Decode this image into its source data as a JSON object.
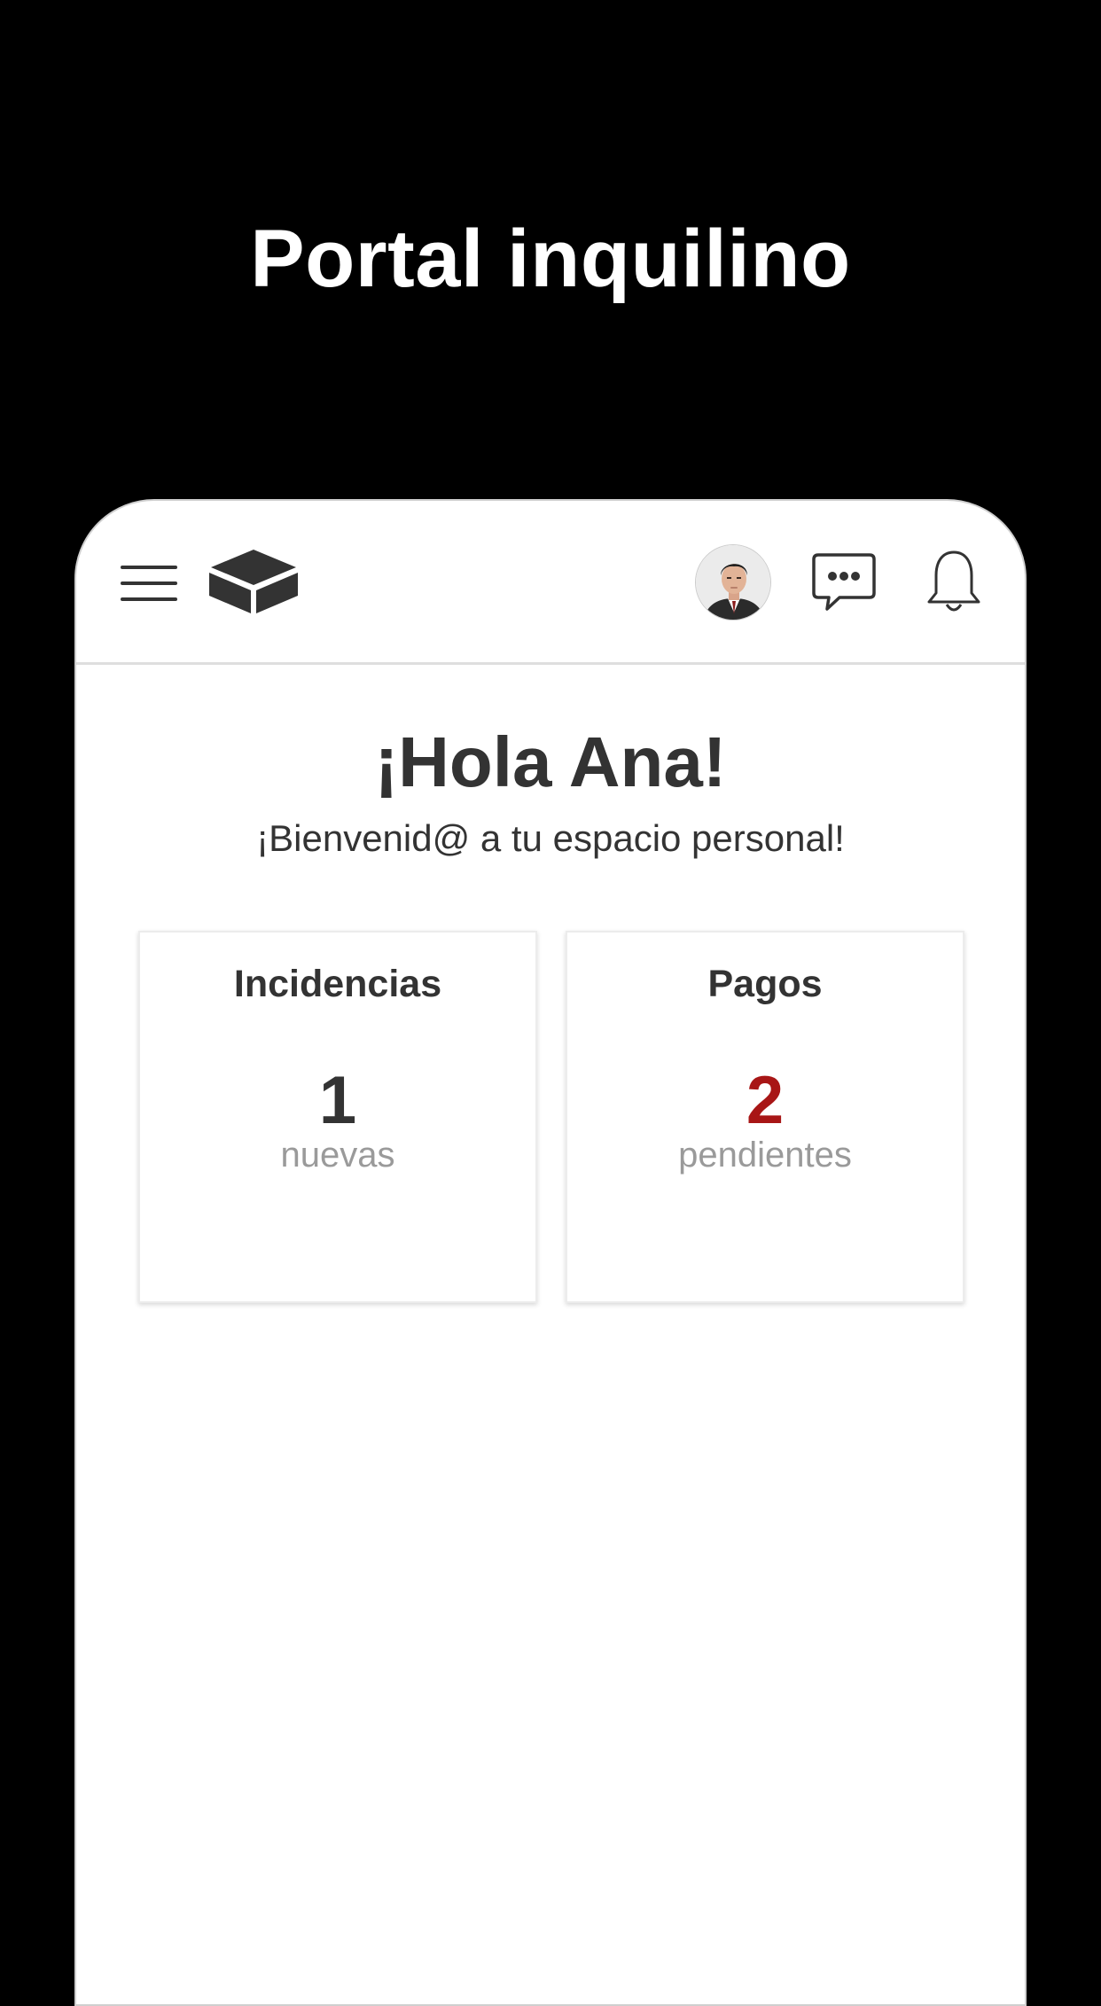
{
  "promo": {
    "title": "Portal inquilino"
  },
  "header": {
    "menu_icon": "hamburger-menu-icon",
    "logo_icon": "box-logo-icon",
    "avatar": "user-avatar-photo",
    "chat_icon": "chat-bubble-icon",
    "bell_icon": "bell-icon"
  },
  "main": {
    "greeting": "¡Hola Ana!",
    "welcome": "¡Bienvenid@ a tu espacio personal!"
  },
  "cards": [
    {
      "title": "Incidencias",
      "count": "1",
      "subtitle": "nuevas",
      "count_color": "#333333"
    },
    {
      "title": "Pagos",
      "count": "2",
      "subtitle": "pendientes",
      "count_color": "#a81616"
    }
  ],
  "colors": {
    "background": "#000000",
    "surface": "#ffffff",
    "text": "#333333",
    "muted": "#9a9a9a",
    "alert": "#a81616"
  }
}
